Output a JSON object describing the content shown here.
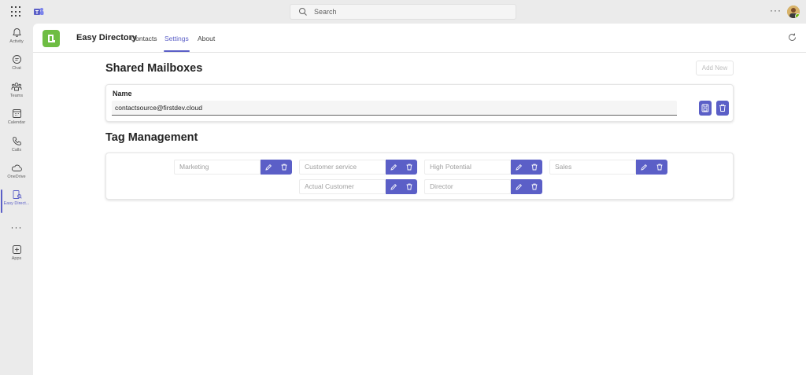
{
  "search": {
    "placeholder": "Search"
  },
  "top": {
    "more": "···"
  },
  "rail": [
    {
      "label": "Activity",
      "icon": "bell-icon"
    },
    {
      "label": "Chat",
      "icon": "chat-icon"
    },
    {
      "label": "Teams",
      "icon": "teams-icon"
    },
    {
      "label": "Calendar",
      "icon": "calendar-icon"
    },
    {
      "label": "Calls",
      "icon": "phone-icon"
    },
    {
      "label": "OneDrive",
      "icon": "cloud-icon"
    },
    {
      "label": "Easy Direct...",
      "icon": "directory-icon",
      "active": true
    },
    {
      "label": "",
      "icon": "more-icon",
      "text": "···"
    },
    {
      "label": "Apps",
      "icon": "add-apps-icon"
    }
  ],
  "app": {
    "title": "Easy Directory",
    "tabs": [
      "Contacts",
      "Settings",
      "About"
    ],
    "active_tab": "Settings"
  },
  "mailboxes": {
    "title": "Shared Mailboxes",
    "add_new": "Add New",
    "field_label": "Name",
    "value": "contactsource@firstdev.cloud"
  },
  "tags": {
    "title": "Tag Management",
    "items": [
      "Marketing",
      "Customer service",
      "High Potential",
      "Sales",
      "Actual Customer",
      "Director"
    ]
  },
  "colors": {
    "accent": "#5b5fc7",
    "app_icon": "#6ebd43"
  }
}
